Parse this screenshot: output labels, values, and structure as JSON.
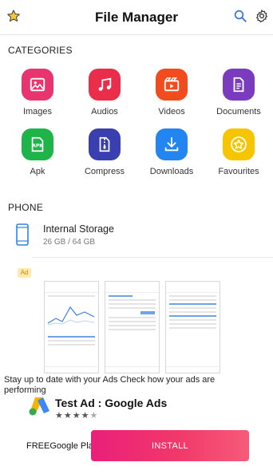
{
  "header": {
    "title": "File Manager",
    "left_icon": "star-icon",
    "right_icons": [
      "search-icon",
      "gear-icon"
    ]
  },
  "categories": {
    "heading": "CATEGORIES",
    "items": [
      {
        "label": "Images",
        "icon": "image-icon",
        "color": "#e8346f"
      },
      {
        "label": "Audios",
        "icon": "music-note-icon",
        "color": "#ea2d4b"
      },
      {
        "label": "Videos",
        "icon": "clapperboard-icon",
        "color": "#f24b1d"
      },
      {
        "label": "Documents",
        "icon": "document-icon",
        "color": "#7b3bbf"
      },
      {
        "label": "Apk",
        "icon": "apk-icon",
        "color": "#1fb44a"
      },
      {
        "label": "Compress",
        "icon": "zip-icon",
        "color": "#3a3fb0"
      },
      {
        "label": "Downloads",
        "icon": "download-icon",
        "color": "#2385f0"
      },
      {
        "label": "Favourites",
        "icon": "star-circle-icon",
        "color": "#f7c400"
      }
    ]
  },
  "phone": {
    "heading": "PHONE",
    "storage_name": "Internal Storage",
    "storage_size": "26 GB / 64 GB"
  },
  "ad": {
    "badge": "Ad",
    "description": "Stay up to date with your Ads Check how your ads are performing",
    "title": "Test Ad : Google Ads",
    "rating_stars": 4.5,
    "price_store": "FREEGoogle Play",
    "install_label": "INSTALL"
  }
}
